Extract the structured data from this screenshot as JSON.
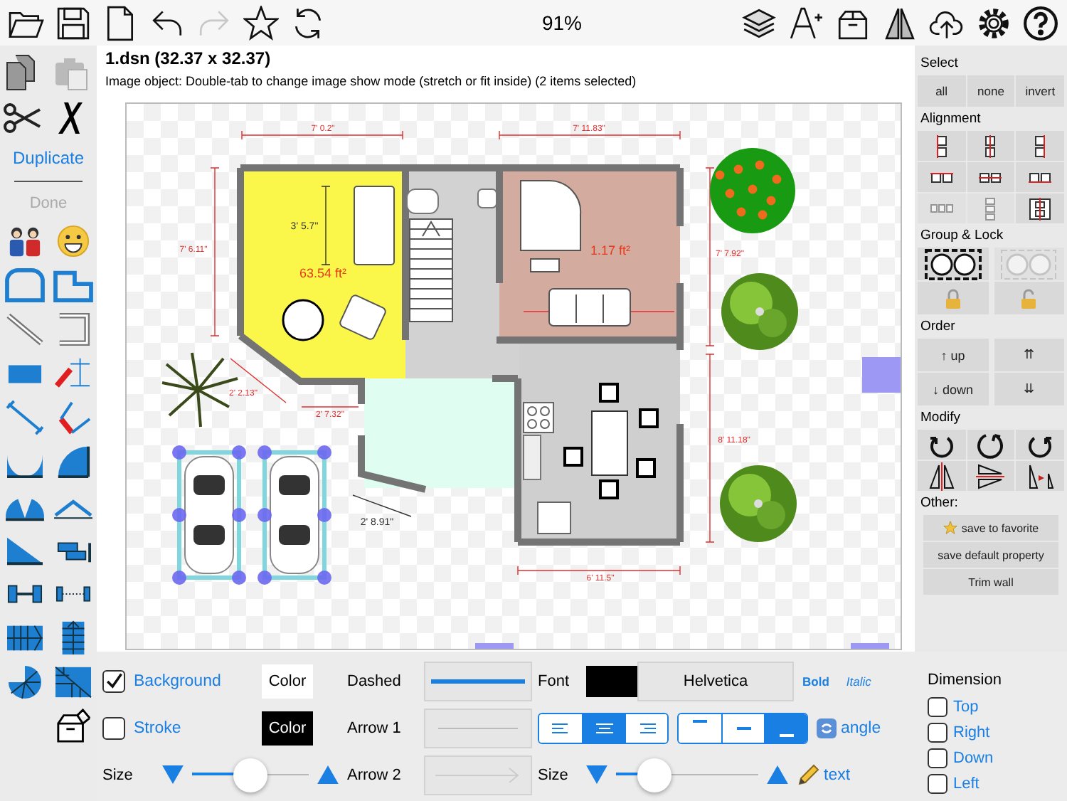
{
  "toolbar": {
    "left_tools": [
      {
        "kind": "folder",
        "disabled": false
      },
      {
        "kind": "save",
        "disabled": false
      },
      {
        "kind": "document",
        "disabled": false
      },
      {
        "kind": "undo",
        "disabled": false
      },
      {
        "kind": "redo",
        "disabled": true
      },
      {
        "kind": "star",
        "disabled": false
      },
      {
        "kind": "refresh",
        "disabled": false
      }
    ],
    "zoom": "91%",
    "right_tools": [
      {
        "kind": "layers"
      },
      {
        "kind": "letter-plus"
      },
      {
        "kind": "box"
      },
      {
        "kind": "mirror-triangles"
      },
      {
        "kind": "cloud-upload"
      },
      {
        "kind": "settings"
      },
      {
        "kind": "help"
      }
    ]
  },
  "edit_tools": [
    {
      "kind": "copy",
      "disabled": false
    },
    {
      "kind": "paste",
      "disabled": true
    },
    {
      "kind": "cut",
      "disabled": false
    },
    {
      "kind": "delete",
      "disabled": false
    }
  ],
  "duplicate": {
    "label": "Duplicate"
  },
  "done": {
    "label": "Done",
    "disabled": true
  },
  "shape_tools": [
    {
      "kind": "people"
    },
    {
      "kind": "smiley"
    },
    {
      "kind": "arch-outline"
    },
    {
      "kind": "l-outline"
    },
    {
      "kind": "diagonal-line"
    },
    {
      "kind": "bracket-line"
    },
    {
      "kind": "rectangle"
    },
    {
      "kind": "slanted-dimension"
    },
    {
      "kind": "diagonal-dimension"
    },
    {
      "kind": "corner-dimension"
    },
    {
      "kind": "double-arc"
    },
    {
      "kind": "quarter-arc"
    },
    {
      "kind": "double-peak"
    },
    {
      "kind": "roof"
    },
    {
      "kind": "wedge"
    },
    {
      "kind": "step-blocks"
    },
    {
      "kind": "dumbbell"
    },
    {
      "kind": "dotted-bar"
    },
    {
      "kind": "grid-stairs"
    },
    {
      "kind": "vertical-stairs"
    },
    {
      "kind": "spiral-stairs"
    },
    {
      "kind": "corner-stairs"
    },
    {
      "kind": "box"
    }
  ],
  "document": {
    "title": "1.dsn (32.37 x 32.37)",
    "hint": "Image object: Double-tab to change image show mode (stretch or fit inside) (2 items selected)"
  },
  "plan": {
    "labels": [
      {
        "text": "7' 0.2\"",
        "kind": "dimension"
      },
      {
        "text": "7' 11.83\"",
        "kind": "dimension"
      },
      {
        "text": "3' 5.7\"",
        "kind": "measure"
      },
      {
        "text": "7' 6.11\"",
        "kind": "dimension"
      },
      {
        "text": "1.17 ft²",
        "kind": "area"
      },
      {
        "text": "7' 7.92\"",
        "kind": "dimension"
      },
      {
        "text": "63.54 ft²",
        "kind": "area"
      },
      {
        "text": "2' 2.13\"",
        "kind": "dimension"
      },
      {
        "text": "2' 7.32\"",
        "kind": "dimension"
      },
      {
        "text": "8' 11.18\"",
        "kind": "dimension"
      },
      {
        "text": "2' 8.91\"",
        "kind": "measure"
      },
      {
        "text": "6' 11.5\"",
        "kind": "dimension"
      }
    ],
    "cars": [
      {
        "selected": true
      },
      {
        "selected": true
      }
    ]
  },
  "select": {
    "title": "Select",
    "buttons": [
      "all",
      "none",
      "invert"
    ]
  },
  "alignment": {
    "title": "Alignment",
    "buttons": [
      {
        "kind": "left",
        "disabled": false
      },
      {
        "kind": "center-h",
        "disabled": false
      },
      {
        "kind": "right",
        "disabled": false
      },
      {
        "kind": "top",
        "disabled": false
      },
      {
        "kind": "center-v",
        "disabled": false
      },
      {
        "kind": "bottom",
        "disabled": false
      },
      {
        "kind": "distribute-h",
        "disabled": true
      },
      {
        "kind": "distribute-v",
        "disabled": true
      },
      {
        "kind": "center-both",
        "disabled": false
      }
    ]
  },
  "group_lock": {
    "title": "Group & Lock",
    "buttons": [
      {
        "kind": "group",
        "disabled": false
      },
      {
        "kind": "ungroup",
        "disabled": true
      },
      {
        "kind": "lock",
        "disabled": false
      },
      {
        "kind": "unlock",
        "disabled": false
      }
    ]
  },
  "order": {
    "title": "Order",
    "buttons": [
      "↑ up",
      "⇈",
      "↓ down",
      "⇊"
    ]
  },
  "modify": {
    "title": "Modify",
    "buttons": [
      {
        "kind": "rotate-left"
      },
      {
        "kind": "rotate-around"
      },
      {
        "kind": "rotate-right"
      },
      {
        "kind": "flip-horizontal"
      },
      {
        "kind": "flip-vertical"
      },
      {
        "kind": "mirror-copy"
      }
    ]
  },
  "other": {
    "title": "Other:",
    "buttons": [
      {
        "label": "save to favorite",
        "kind": "favorite"
      },
      {
        "label": "save default property",
        "kind": "plain"
      },
      {
        "label": "Trim wall",
        "kind": "plain"
      }
    ]
  },
  "style_rows": [
    {
      "label": "Background",
      "checked": true,
      "button": "Color",
      "color": "#ffffff"
    },
    {
      "label": "Stroke",
      "checked": false,
      "button": "Color",
      "color": "#000000"
    }
  ],
  "size": {
    "label": "Size",
    "level": 0.5
  },
  "line": {
    "dashed": "Dashed",
    "arrow1": "Arrow 1",
    "arrow2": "Arrow 2"
  },
  "font": {
    "label": "Font",
    "name": "Helvetica",
    "bold": "Bold",
    "italic": "Italic"
  },
  "text_align": [
    {
      "selected": false
    },
    {
      "selected": true
    },
    {
      "selected": false
    }
  ],
  "vertical_align": [
    {
      "selected": false
    },
    {
      "selected": false
    },
    {
      "selected": true
    }
  ],
  "angle": "angle",
  "text_size": {
    "label": "Size",
    "level": 0.27
  },
  "text_button": "text",
  "dimension": {
    "title": "Dimension",
    "options": [
      {
        "label": "Top",
        "checked": false
      },
      {
        "label": "Right",
        "checked": false
      },
      {
        "label": "Down",
        "checked": false
      },
      {
        "label": "Left",
        "checked": false
      }
    ]
  }
}
